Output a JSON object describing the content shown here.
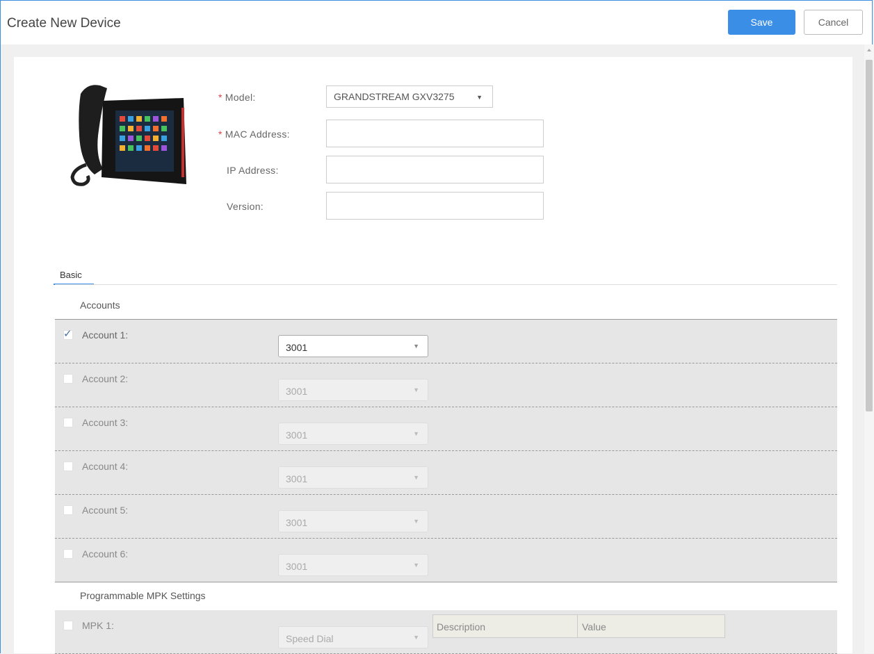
{
  "header": {
    "title": "Create New Device",
    "save_label": "Save",
    "cancel_label": "Cancel"
  },
  "form": {
    "model_label": "Model:",
    "model_value": "GRANDSTREAM GXV3275",
    "mac_label": "MAC Address:",
    "ip_label": "IP Address:",
    "version_label": "Version:",
    "required_mark": "*"
  },
  "tabs": {
    "basic": "Basic"
  },
  "accounts": {
    "title": "Accounts",
    "items": [
      {
        "label": "Account 1:",
        "value": "3001",
        "checked": true
      },
      {
        "label": "Account 2:",
        "value": "3001",
        "checked": false
      },
      {
        "label": "Account 3:",
        "value": "3001",
        "checked": false
      },
      {
        "label": "Account 4:",
        "value": "3001",
        "checked": false
      },
      {
        "label": "Account 5:",
        "value": "3001",
        "checked": false
      },
      {
        "label": "Account 6:",
        "value": "3001",
        "checked": false
      }
    ]
  },
  "mpk": {
    "title": "Programmable MPK Settings",
    "items": [
      {
        "label": "MPK 1:",
        "type": "Speed Dial",
        "description_placeholder": "Description",
        "value_placeholder": "Value"
      }
    ]
  },
  "icons": {
    "checkmark": "check-icon",
    "caret": "dropdown-caret-icon"
  }
}
